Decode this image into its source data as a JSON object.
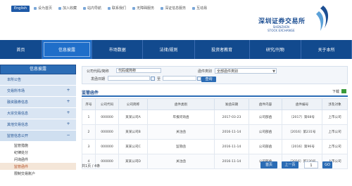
{
  "header": {
    "lang_button": "English",
    "top_links": [
      "设为首页",
      "加入收藏",
      "站内导航",
      "联系我们",
      "无障碍服务",
      "深证信息服务",
      "互动易"
    ],
    "logo_cn": "深圳证券交易所",
    "logo_en_line1": "SHENZHEN",
    "logo_en_line2": "STOCK EXCHANGE",
    "brand_color": "#124a8e"
  },
  "nav": {
    "items": [
      "首页",
      "信息披露",
      "市场数据",
      "法律/规则",
      "投资者教育",
      "研究/刊物",
      "关于本所"
    ],
    "active_index": 1
  },
  "sidebar": {
    "title": "信息披露",
    "items": [
      {
        "label": "本所公告",
        "toggle": ""
      },
      {
        "label": "交易所市场",
        "toggle": "+"
      },
      {
        "label": "融资融券信息",
        "toggle": "+"
      },
      {
        "label": "大宗交易信息",
        "toggle": "+"
      },
      {
        "label": "其他交易信息",
        "toggle": "+"
      },
      {
        "label": "监管信息公开",
        "toggle": "−"
      }
    ],
    "subitems": [
      "监管措施",
      "纪律处分",
      "问询函件",
      "监管函件",
      "限制交易账户"
    ],
    "active_sub": 3
  },
  "search": {
    "company_label": "公司代码/简称",
    "company_value": "代码或简称",
    "type_label": "函件类别",
    "type_value": "全部函件类别",
    "date_label": "发函日期",
    "date_sep": "至",
    "query_button": "查询"
  },
  "section": {
    "title": "监管函件",
    "download_label": "下载"
  },
  "table": {
    "headers": [
      "序号",
      "公司代码",
      "公司简称",
      "函件类别",
      "发函日期",
      "函件内容",
      "函件编号",
      "涉及对象"
    ],
    "rows": [
      [
        "1",
        "000000",
        "某某公司A",
        "年报问询函",
        "2017-03-23",
        "公司部函",
        "〔2017〕第68号",
        "上市公司"
      ],
      [
        "2",
        "000000",
        "某某公司B",
        "关注函",
        "2016-11-14",
        "公司部函",
        "〔2016〕第231号",
        "上市公司"
      ],
      [
        "3",
        "000000",
        "某某公司C",
        "监管函",
        "2016-11-14",
        "公司部函",
        "〔2016〕第96号",
        "上市公司"
      ],
      [
        "4",
        "000000",
        "某某公司D",
        "关注函",
        "2016-11-14",
        "公司部函",
        "〔2016〕第230号",
        "上市公司"
      ]
    ]
  },
  "pager": {
    "info": "共1页 / 4条",
    "first": "首页",
    "prev": "上一页",
    "page_value": "1",
    "go": "GO"
  }
}
